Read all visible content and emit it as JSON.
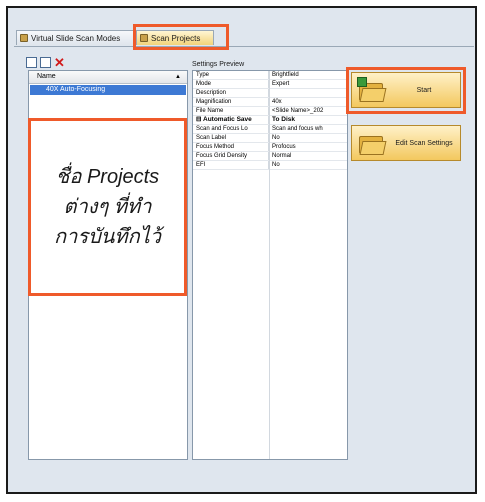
{
  "tabs": [
    {
      "label": "Virtual Slide Scan Modes",
      "active": false
    },
    {
      "label": "Scan Projects",
      "active": true
    }
  ],
  "projects_list": {
    "column_header": "Name",
    "items": [
      "40X Auto-Focusing"
    ]
  },
  "overlay_note": {
    "lines": [
      "ชื่อ Projects",
      "ต่างๆ ที่ทำ",
      "การบันทึกไว้"
    ]
  },
  "settings_preview": {
    "label": "Settings Preview",
    "rows": [
      {
        "key": "Type",
        "value": "Brightfield",
        "group": false
      },
      {
        "key": "Mode",
        "value": "Expert",
        "group": false
      },
      {
        "key": "Description",
        "value": "",
        "group": false
      },
      {
        "key": "Magnification",
        "value": "40x",
        "group": false
      },
      {
        "key": "File Name",
        "value": "<Slide Name>_202",
        "group": false
      },
      {
        "key": "⊟ Automatic Save",
        "value": "To Disk",
        "group": true
      },
      {
        "key": "Scan and Focus Lo",
        "value": "Scan and focus wh",
        "group": false
      },
      {
        "key": "Scan Label",
        "value": "No",
        "group": false
      },
      {
        "key": "Focus Method",
        "value": "Profocus",
        "group": false
      },
      {
        "key": "Focus Grid Density",
        "value": "Normal",
        "group": false
      },
      {
        "key": "EFI",
        "value": "No",
        "group": false
      }
    ]
  },
  "actions": {
    "start_label": "Start",
    "edit_label": "Edit Scan Settings"
  },
  "colors": {
    "highlight": "#ef5a2a",
    "selection": "#3d79d4"
  }
}
